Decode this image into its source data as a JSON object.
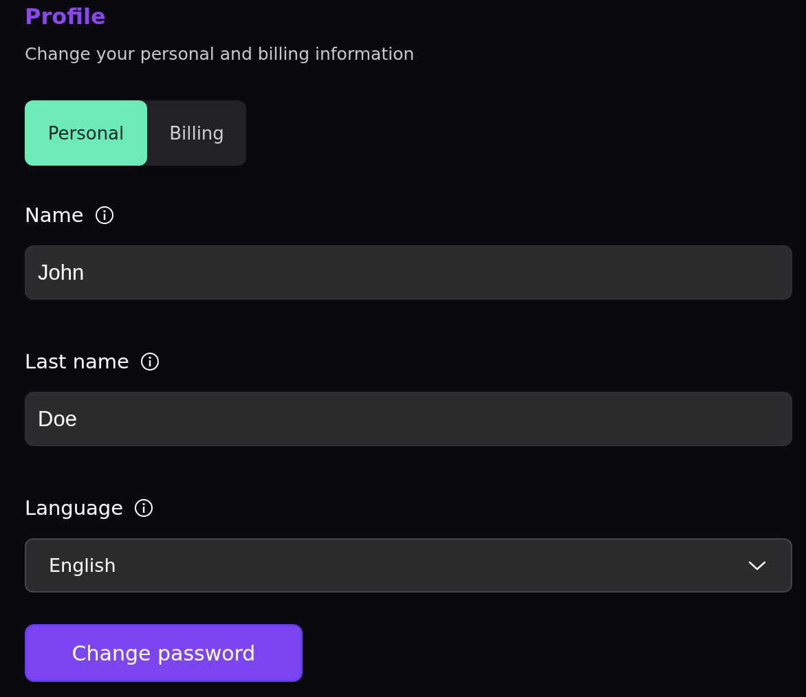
{
  "header": {
    "title": "Profile",
    "subtitle": "Change your personal and billing information"
  },
  "tabs": [
    {
      "label": "Personal",
      "selected": true
    },
    {
      "label": "Billing",
      "selected": false
    }
  ],
  "fields": [
    {
      "kind": "text",
      "label": "Name",
      "value": "John"
    },
    {
      "kind": "text",
      "label": "Last name",
      "value": "Doe"
    },
    {
      "kind": "select",
      "label": "Language",
      "value": "English"
    }
  ],
  "button": {
    "label": "Change password"
  }
}
